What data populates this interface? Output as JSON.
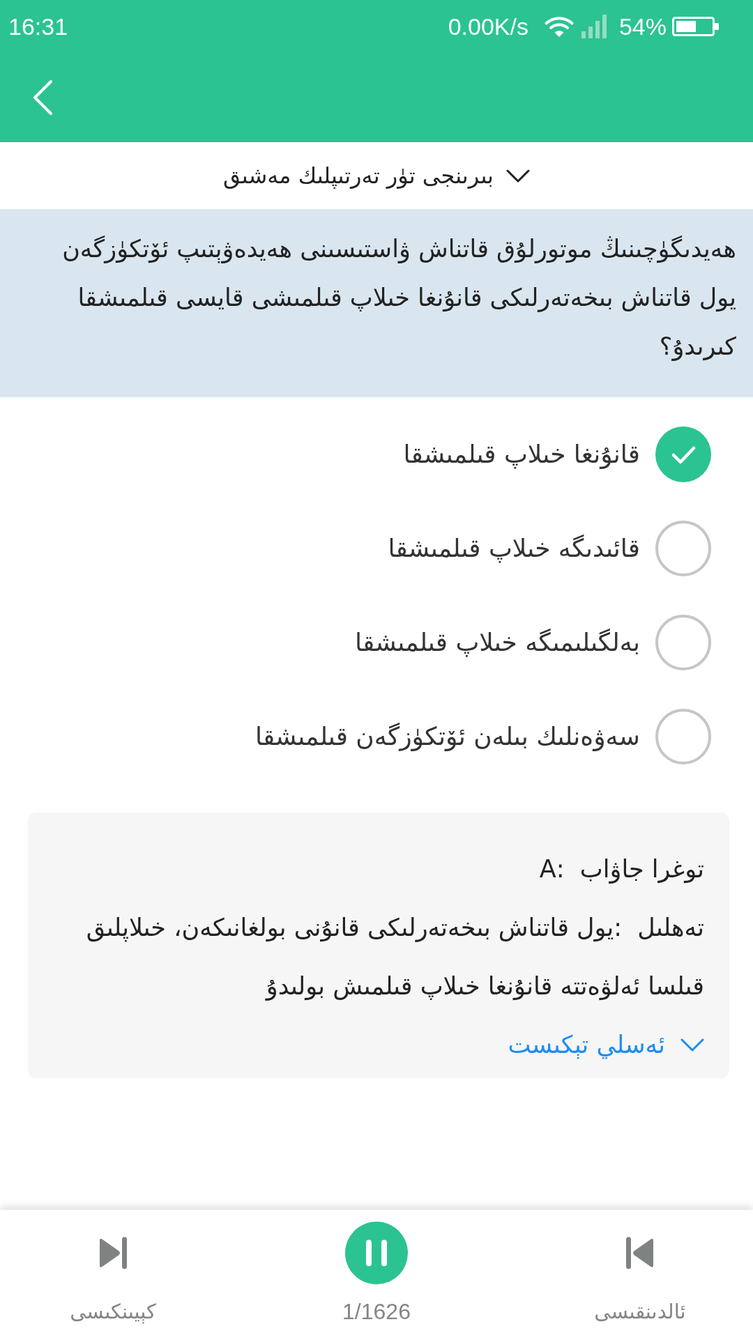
{
  "status_bar": {
    "time": "16:31",
    "network_speed": "0.00K/s",
    "battery": "54%"
  },
  "practice_selector": {
    "label": "بىرىنجى تۈر تەرتىپلىك مەشىق",
    "expanded": false
  },
  "question": {
    "text": "ھەيدىگۈچىنىڭ موتورلۇق قاتناش ۋاستىسىنى ھەيدەۋېتىپ ئۆتكۈزگەن يول قاتناش بىخەتەرلىكى قانۇنغا خىلاپ قىلمىشى قايسى قىلمىشقا كىرىدۇ؟"
  },
  "options": [
    {
      "text": "قانۇنغا خىلاپ قىلمىشقا",
      "selected": true
    },
    {
      "text": "قائىدىگە خىلاپ قىلمىشقا",
      "selected": false
    },
    {
      "text": "بەلگىلىمىگە خىلاپ قىلمىشقا",
      "selected": false
    },
    {
      "text": "سەۋەنلىك بىلەن ئۆتكۈزگەن قىلمىشقا",
      "selected": false
    }
  ],
  "explanation": {
    "answer": "توغرا جاۋاب  :A",
    "analysis": "تەھلىل  :يول قاتناش بىخەتەرلىكى قانۇنى بولغانىكەن، خىلاپلىق قىلسا ئەلۋەتتە قانۇنغا خىلاپ قىلمىش بولىدۇ",
    "original_text": {
      "label": "ئەسلي تېكىست",
      "expanded": false
    }
  },
  "bottom_bar": {
    "next": "كېيىنكىسى",
    "counter": "1/1626",
    "previous": "ئالدىنقىسى",
    "playing": true
  }
}
